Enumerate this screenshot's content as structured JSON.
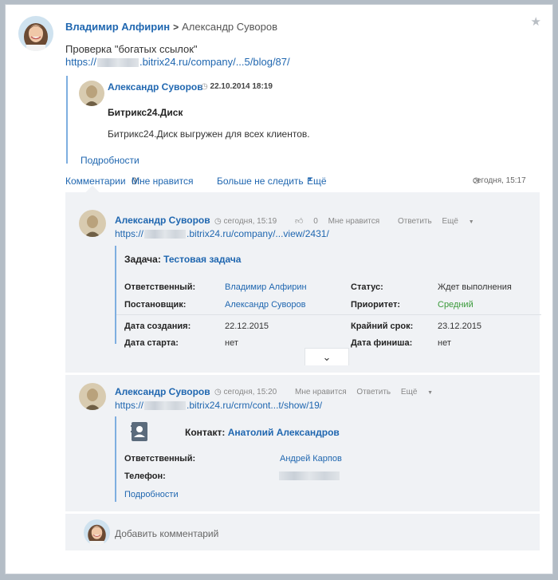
{
  "post": {
    "author": "Владимир Алфирин",
    "recipient": "Александр Суворов",
    "title": "Проверка \"богатых ссылок\"",
    "link_prefix": "https://",
    "link_suffix": ".bitrix24.ru/company/...5/blog/87/"
  },
  "quote": {
    "author": "Александр Суворов",
    "date": "22.10.2014 18:19",
    "title": "Битрикс24.Диск",
    "body": "Битрикс24.Диск выгружен для всех клиентов.",
    "more": "Подробности"
  },
  "actions": {
    "comments": "Комментарии",
    "likes": "0",
    "like_label": "Мне нравится",
    "unfollow": "Больше не следить",
    "more": "Ещё",
    "time": "сегодня, 15:17"
  },
  "comments": [
    {
      "author": "Александр Суворов",
      "time": "сегодня, 15:19",
      "likes": "0",
      "like_label": "Мне нравится",
      "reply": "Ответить",
      "more": "Ещё",
      "link_prefix": "https://",
      "link_suffix": ".bitrix24.ru/company/...view/2431/",
      "task": {
        "label": "Задача:",
        "name": "Тестовая задача",
        "responsible_label": "Ответственный:",
        "responsible": "Владимир Алфирин",
        "status_label": "Статус:",
        "status": "Ждет выполнения",
        "creator_label": "Постановщик:",
        "creator": "Александр Суворов",
        "priority_label": "Приоритет:",
        "priority": "Средний",
        "created_label": "Дата создания:",
        "created": "22.12.2015",
        "deadline_label": "Крайний срок:",
        "deadline": "23.12.2015",
        "start_label": "Дата старта:",
        "start": "нет",
        "finish_label": "Дата финиша:",
        "finish": "нет"
      }
    },
    {
      "author": "Александр Суворов",
      "time": "сегодня, 15:20",
      "likes": "",
      "like_label": "Мне нравится",
      "reply": "Ответить",
      "more": "Ещё",
      "link_prefix": "https://",
      "link_suffix": ".bitrix24.ru/crm/cont...t/show/19/",
      "contact": {
        "label": "Контакт:",
        "name": "Анатолий Александров",
        "responsible_label": "Ответственный:",
        "responsible": "Андрей Карпов",
        "phone_label": "Телефон:",
        "more": "Подробности"
      }
    }
  ],
  "add_comment": "Добавить комментарий",
  "colors": {
    "link": "#2067b0",
    "accent_border": "#7eaee0",
    "priority": "#3a9a3a",
    "panel": "#f0f2f5"
  }
}
